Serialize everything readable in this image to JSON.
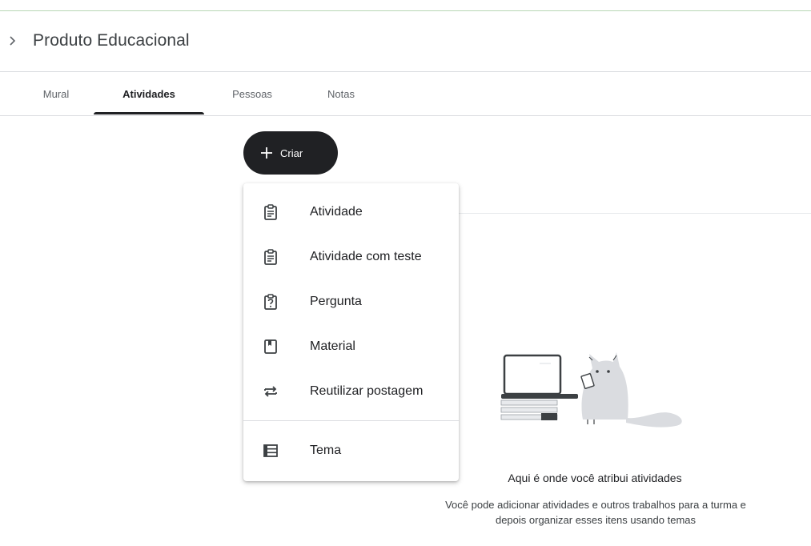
{
  "breadcrumb": {
    "chevron_icon": "chevron-right-icon",
    "title": "Produto Educacional"
  },
  "tabs": [
    {
      "label": "Mural",
      "active": false
    },
    {
      "label": "Atividades",
      "active": true
    },
    {
      "label": "Pessoas",
      "active": false
    },
    {
      "label": "Notas",
      "active": false
    }
  ],
  "create_button": {
    "icon": "plus-icon",
    "label": "Criar"
  },
  "create_menu": {
    "items": [
      {
        "label": "Atividade",
        "icon": "assignment-icon"
      },
      {
        "label": "Atividade com teste",
        "icon": "quiz-assignment-icon"
      },
      {
        "label": "Pergunta",
        "icon": "question-icon"
      },
      {
        "label": "Material",
        "icon": "material-icon"
      },
      {
        "label": "Reutilizar postagem",
        "icon": "repeat-icon"
      },
      {
        "label": "Tema",
        "icon": "topic-list-icon"
      }
    ]
  },
  "empty_state": {
    "illustration": "cat-with-laptop-illustration",
    "title": "Aqui é onde você atribui atividades",
    "description": "Você pode adicionar atividades e outros trabalhos para a turma e depois organizar esses itens usando temas"
  },
  "colors": {
    "accent_dark": "#202124",
    "divider": "#dadce0",
    "top_line": "#b7d7b4"
  }
}
